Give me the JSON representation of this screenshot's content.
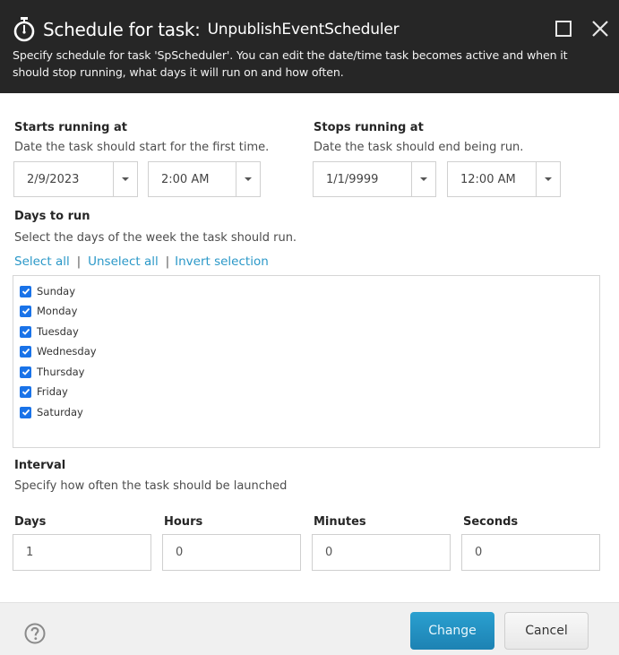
{
  "dialog": {
    "title_prefix": "Schedule for task:",
    "task_name": "UnpublishEventScheduler",
    "description": "Specify schedule for task 'SpScheduler'. You can edit the date/time task becomes active and when it should stop running, what days it will run on and how often.",
    "icons": {
      "title": "stopwatch-icon",
      "maximize": "maximize-icon",
      "close": "close-icon"
    }
  },
  "starts": {
    "title": "Starts running at",
    "description": "Date the task should start for the first time.",
    "date": "2/9/2023",
    "time": "2:00 AM"
  },
  "stops": {
    "title": "Stops running at",
    "description": "Date the task should end being run.",
    "date": "1/1/9999",
    "time": "12:00 AM"
  },
  "days_to_run": {
    "title": "Days to run",
    "description": "Select the days of the week the task should run.",
    "links": {
      "select_all": "Select all",
      "unselect_all": "Unselect all",
      "invert_selection": "Invert selection",
      "separator": "|"
    },
    "days": [
      {
        "label": "Sunday",
        "checked": true
      },
      {
        "label": "Monday",
        "checked": true
      },
      {
        "label": "Tuesday",
        "checked": true
      },
      {
        "label": "Wednesday",
        "checked": true
      },
      {
        "label": "Thursday",
        "checked": true
      },
      {
        "label": "Friday",
        "checked": true
      },
      {
        "label": "Saturday",
        "checked": true
      }
    ]
  },
  "interval": {
    "title": "Interval",
    "description": "Specify how often the task should be launched",
    "fields": [
      {
        "label": "Days",
        "value": "1"
      },
      {
        "label": "Hours",
        "value": "0"
      },
      {
        "label": "Minutes",
        "value": "0"
      },
      {
        "label": "Seconds",
        "value": "0"
      }
    ]
  },
  "footer": {
    "change_label": "Change",
    "cancel_label": "Cancel",
    "help_icon": "help-icon"
  },
  "colors": {
    "header_bg": "#262626",
    "link": "#2b98c8",
    "primary_button": "#2594c6",
    "checkbox": "#1a73e8"
  }
}
